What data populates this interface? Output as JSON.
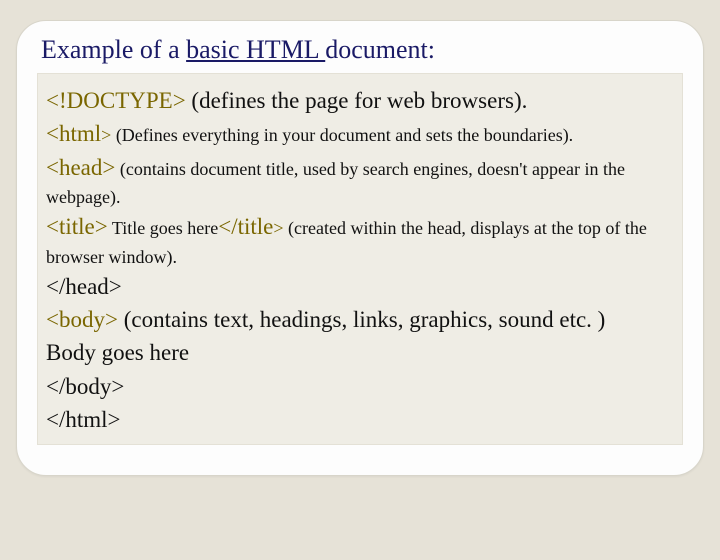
{
  "title": {
    "prefix": "Example of a ",
    "underlined": "basic HTML ",
    "suffix": "document:"
  },
  "lines": {
    "doctype_tag": "<!DOCTYPE>",
    "doctype_desc": " (defines the page for web browsers).",
    "html_tag": "<html",
    "html_gt": ">",
    "html_desc": " (Defines everything in your document and sets the boundaries).",
    "head_tag": "<head>",
    "head_desc": " (contains document title, used by search engines, doesn't appear in the webpage).",
    "title_open": "<title>",
    "title_text": " Title goes here",
    "title_close": "</title",
    "title_gt": ">",
    "title_desc": " (created within the head, displays at the top of the browser window).",
    "head_close": "</head>",
    "body_open": "<body>",
    "body_desc": " (contains text, headings, links, graphics, sound etc. )",
    "body_text": "Body goes here",
    "body_close": "</body>",
    "html_close": "</html>"
  }
}
